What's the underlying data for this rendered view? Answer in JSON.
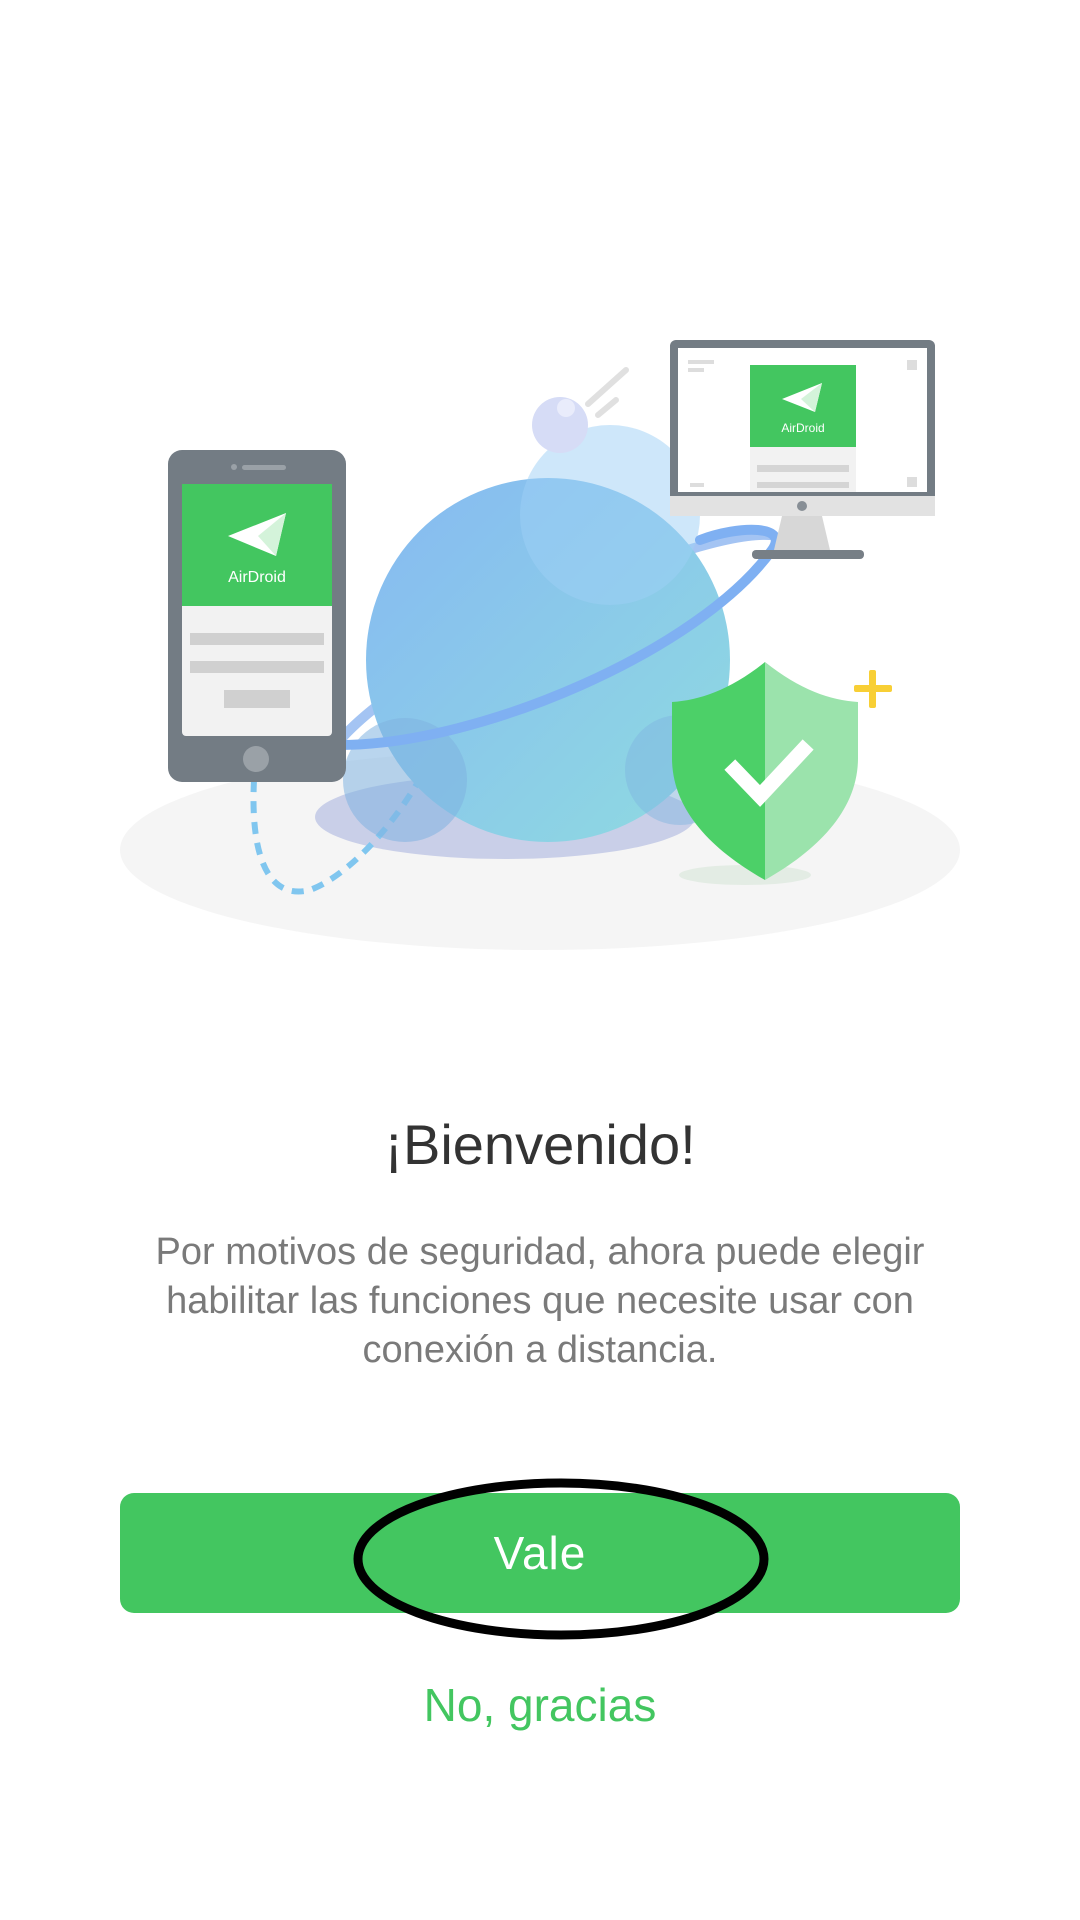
{
  "welcome": {
    "title": "¡Bienvenido!",
    "description": "Por motivos de seguridad, ahora puede elegir habilitar las funciones que necesite usar con conexión a distancia.",
    "ok_label": "Vale",
    "decline_label": "No, gracias"
  },
  "illustration": {
    "phone_app_name": "AirDroid",
    "monitor_app_name": "AirDroid"
  },
  "colors": {
    "accent": "#43c660",
    "title": "#333333",
    "body_text": "#7a7a7a",
    "globe": "#8cc4ee",
    "shield": "#4cd068",
    "device_frame": "#737c84"
  },
  "icons": [
    "airdroid-logo-icon",
    "shield-check-icon",
    "plus-sparkle-icon"
  ]
}
